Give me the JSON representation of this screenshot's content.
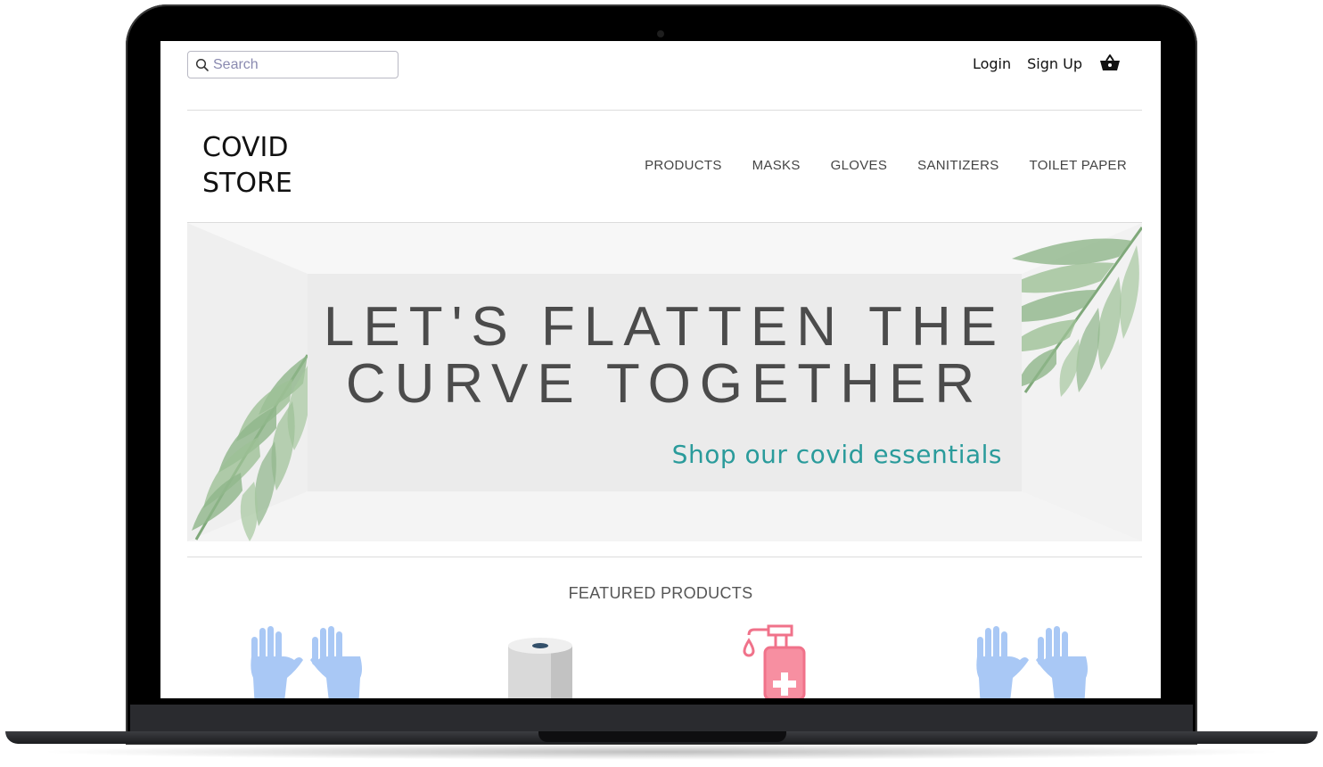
{
  "search": {
    "placeholder": "Search"
  },
  "header": {
    "login_label": "Login",
    "signup_label": "Sign Up"
  },
  "brand": {
    "line1": "COVID",
    "line2": "STORE"
  },
  "nav": {
    "items": [
      "PRODUCTS",
      "MASKS",
      "GLOVES",
      "SANITIZERS",
      "TOILET PAPER"
    ]
  },
  "hero": {
    "title": "LET'S FLATTEN THE\nCURVE TOGETHER",
    "subtitle": "Shop our covid essentials"
  },
  "featured": {
    "heading": "FEATURED PRODUCTS",
    "products": [
      {
        "icon": "gloves-icon"
      },
      {
        "icon": "toilet-paper-icon"
      },
      {
        "icon": "sanitizer-icon"
      },
      {
        "icon": "gloves-icon"
      }
    ]
  },
  "colors": {
    "accent": "#2a9b9b",
    "glove": "#a9c8f5",
    "sanitizer": "#f0728a",
    "leaf": "#8fb58a"
  }
}
